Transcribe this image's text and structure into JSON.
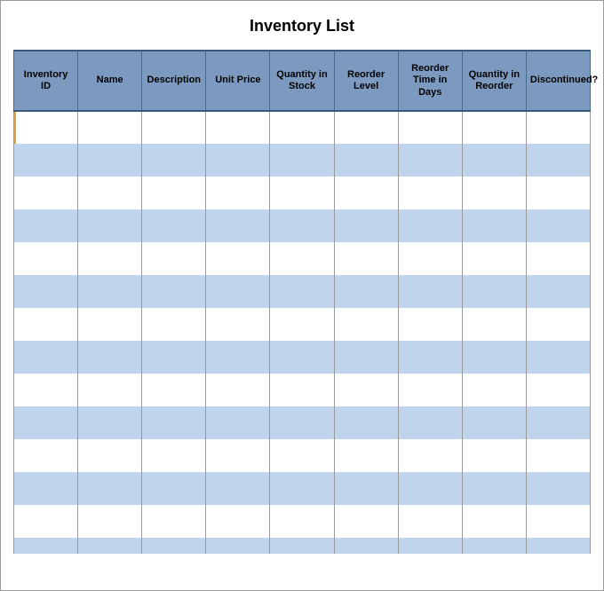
{
  "title": "Inventory List",
  "columns": [
    "Inventory ID",
    "Name",
    "Description",
    "Unit Price",
    "Quantity in Stock",
    "Reorder Level",
    "Reorder Time in Days",
    "Quantity in Reorder",
    "Discontinued?"
  ],
  "rows": [
    [
      "",
      "",
      "",
      "",
      "",
      "",
      "",
      "",
      ""
    ],
    [
      "",
      "",
      "",
      "",
      "",
      "",
      "",
      "",
      ""
    ],
    [
      "",
      "",
      "",
      "",
      "",
      "",
      "",
      "",
      ""
    ],
    [
      "",
      "",
      "",
      "",
      "",
      "",
      "",
      "",
      ""
    ],
    [
      "",
      "",
      "",
      "",
      "",
      "",
      "",
      "",
      ""
    ],
    [
      "",
      "",
      "",
      "",
      "",
      "",
      "",
      "",
      ""
    ],
    [
      "",
      "",
      "",
      "",
      "",
      "",
      "",
      "",
      ""
    ],
    [
      "",
      "",
      "",
      "",
      "",
      "",
      "",
      "",
      ""
    ],
    [
      "",
      "",
      "",
      "",
      "",
      "",
      "",
      "",
      ""
    ],
    [
      "",
      "",
      "",
      "",
      "",
      "",
      "",
      "",
      ""
    ],
    [
      "",
      "",
      "",
      "",
      "",
      "",
      "",
      "",
      ""
    ],
    [
      "",
      "",
      "",
      "",
      "",
      "",
      "",
      "",
      ""
    ],
    [
      "",
      "",
      "",
      "",
      "",
      "",
      "",
      "",
      ""
    ],
    [
      "",
      "",
      "",
      "",
      "",
      "",
      "",
      "",
      ""
    ]
  ]
}
